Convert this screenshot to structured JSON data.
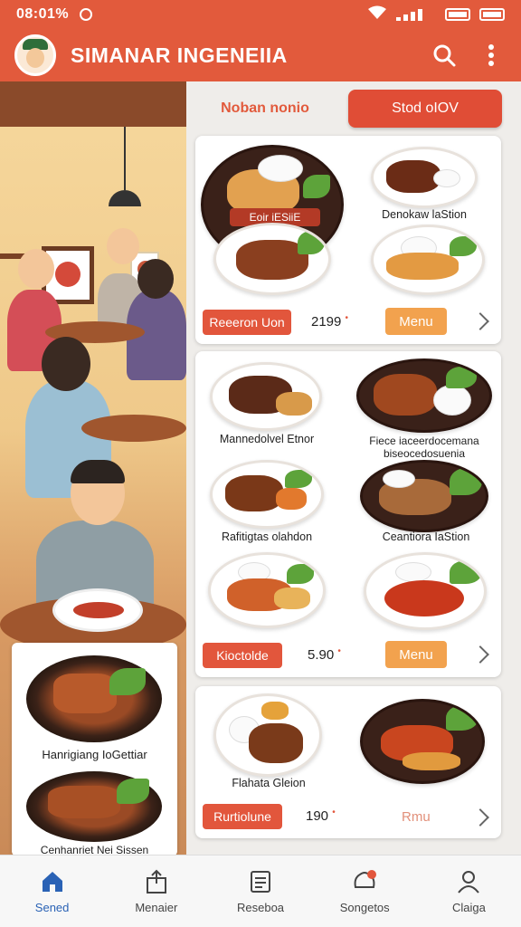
{
  "status_bar": {
    "time": "08:01%"
  },
  "app": {
    "title": "SIMANAR INGENEIIA"
  },
  "tabs": [
    {
      "label": "Noban nonio"
    },
    {
      "label": "Stod oIOV"
    }
  ],
  "left_card": {
    "items": [
      {
        "label": "Hanrigiang IoGettiar"
      },
      {
        "label": "Cenhanriet Nei Sissen"
      }
    ]
  },
  "cards": [
    {
      "badge": "Eoir iESiiE",
      "dishes": [
        {
          "label": "Denokaw laStion"
        }
      ],
      "button": "Reeeron Uon",
      "price": "2199",
      "menu_label": "Menu"
    },
    {
      "dishes": [
        {
          "label": "Mannedolvel Etnor"
        },
        {
          "label": "Fiece iaceerdocemana biseocedosuenia"
        },
        {
          "label": "Rafitigtas olahdon"
        },
        {
          "label": "Ceantiora IaStion"
        }
      ],
      "button": "Kioctolde",
      "price": "5.90",
      "menu_label": "Menu"
    },
    {
      "dishes": [
        {
          "label": "Flahata Gleion"
        }
      ],
      "button": "Rurtiolune",
      "price": "190",
      "menu_label": "Rmu"
    }
  ],
  "nav": [
    {
      "label": "Sened",
      "icon": "home-icon"
    },
    {
      "label": "Menaier",
      "icon": "share-icon"
    },
    {
      "label": "Reseboa",
      "icon": "list-icon"
    },
    {
      "label": "Songetos",
      "icon": "notification-icon"
    },
    {
      "label": "Claiga",
      "icon": "profile-icon"
    }
  ],
  "colors": {
    "accent": "#e25a3c",
    "active_nav": "#2a62b5",
    "menu_button": "#f2a24e"
  }
}
